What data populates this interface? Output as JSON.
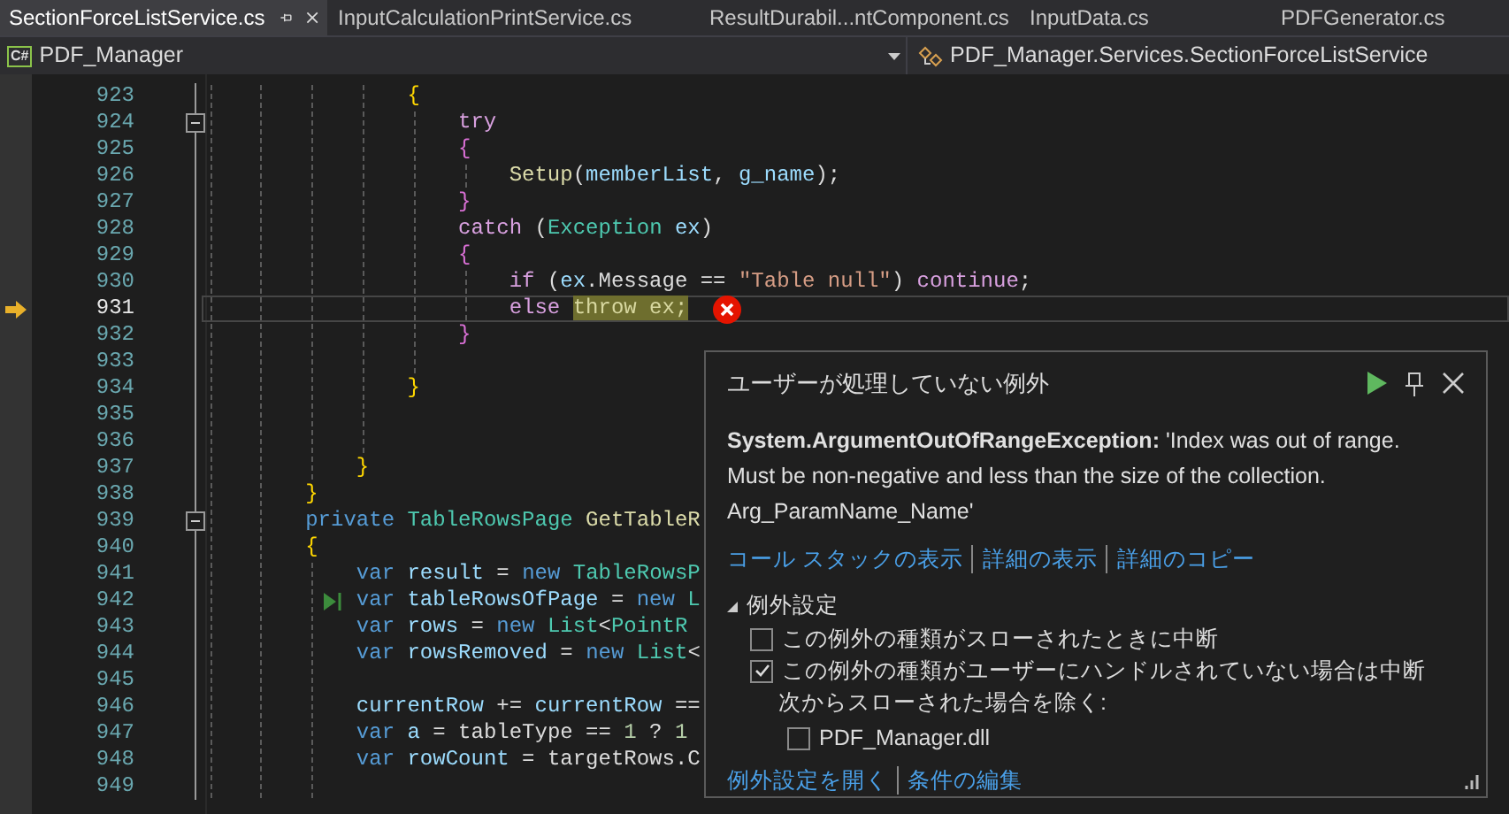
{
  "tabs": [
    {
      "label": "SectionForceListService.cs",
      "selected": true
    },
    {
      "label": "InputCalculationPrintService.cs",
      "selected": false
    },
    {
      "label": "ResultDurabil...ntComponent.cs",
      "selected": false
    },
    {
      "label": "InputData.cs",
      "selected": false
    },
    {
      "label": "PDFGenerator.cs",
      "selected": false
    }
  ],
  "navigation": {
    "project": "PDF_Manager",
    "project_icon": "C#",
    "member": "PDF_Manager.Services.SectionForceListService"
  },
  "editor": {
    "lines": [
      {
        "number": "923",
        "current": false,
        "foldable": false,
        "run_to_cursor": false,
        "error": false,
        "tokens": [
          {
            "text": "                {",
            "kind": "brace"
          }
        ]
      },
      {
        "number": "924",
        "current": false,
        "foldable": true,
        "run_to_cursor": false,
        "error": false,
        "tokens": [
          {
            "text": "                    try",
            "kind": "control"
          }
        ]
      },
      {
        "number": "925",
        "current": false,
        "foldable": false,
        "run_to_cursor": false,
        "error": false,
        "tokens": [
          {
            "text": "                    {",
            "kind": "inner-brace"
          }
        ]
      },
      {
        "number": "926",
        "current": false,
        "foldable": false,
        "run_to_cursor": false,
        "error": false,
        "tokens": [
          {
            "text": "                        Setup",
            "kind": "method"
          },
          {
            "text": "(",
            "kind": "plain"
          },
          {
            "text": "memberList",
            "kind": "local"
          },
          {
            "text": ", ",
            "kind": "plain"
          },
          {
            "text": "g_name",
            "kind": "local"
          },
          {
            "text": ");",
            "kind": "plain"
          }
        ]
      },
      {
        "number": "927",
        "current": false,
        "foldable": false,
        "run_to_cursor": false,
        "error": false,
        "tokens": [
          {
            "text": "                    }",
            "kind": "inner-brace"
          }
        ]
      },
      {
        "number": "928",
        "current": false,
        "foldable": false,
        "run_to_cursor": false,
        "error": false,
        "tokens": [
          {
            "text": "                    catch",
            "kind": "control"
          },
          {
            "text": " (",
            "kind": "plain"
          },
          {
            "text": "Exception",
            "kind": "type"
          },
          {
            "text": " ex",
            "kind": "local"
          },
          {
            "text": ")",
            "kind": "plain"
          }
        ]
      },
      {
        "number": "929",
        "current": false,
        "foldable": false,
        "run_to_cursor": false,
        "error": false,
        "tokens": [
          {
            "text": "                    {",
            "kind": "inner-brace"
          }
        ]
      },
      {
        "number": "930",
        "current": false,
        "foldable": false,
        "run_to_cursor": false,
        "error": false,
        "tokens": [
          {
            "text": "                        if",
            "kind": "control"
          },
          {
            "text": " (",
            "kind": "plain"
          },
          {
            "text": "ex",
            "kind": "local"
          },
          {
            "text": ".Message == ",
            "kind": "plain"
          },
          {
            "text": "\"Table null\"",
            "kind": "string"
          },
          {
            "text": ") ",
            "kind": "plain"
          },
          {
            "text": "continue",
            "kind": "control"
          },
          {
            "text": ";",
            "kind": "plain"
          }
        ]
      },
      {
        "number": "931",
        "current": true,
        "foldable": false,
        "run_to_cursor": false,
        "error": true,
        "tokens": [
          {
            "text": "                        else ",
            "kind": "control"
          },
          {
            "text": "throw ex;",
            "kind": "highlight"
          }
        ]
      },
      {
        "number": "932",
        "current": false,
        "foldable": false,
        "run_to_cursor": false,
        "error": false,
        "tokens": [
          {
            "text": "                    }",
            "kind": "inner-brace"
          }
        ]
      },
      {
        "number": "933",
        "current": false,
        "foldable": false,
        "run_to_cursor": false,
        "error": false
      },
      {
        "number": "934",
        "current": false,
        "foldable": false,
        "run_to_cursor": false,
        "error": false,
        "tokens": [
          {
            "text": "                }",
            "kind": "brace"
          }
        ]
      },
      {
        "number": "935",
        "current": false,
        "foldable": false,
        "run_to_cursor": false,
        "error": false
      },
      {
        "number": "936",
        "current": false,
        "foldable": false,
        "run_to_cursor": false,
        "error": false
      },
      {
        "number": "937",
        "current": false,
        "foldable": false,
        "run_to_cursor": false,
        "error": false,
        "tokens": [
          {
            "text": "            }",
            "kind": "brace"
          }
        ]
      },
      {
        "number": "938",
        "current": false,
        "foldable": false,
        "run_to_cursor": false,
        "error": false,
        "tokens": [
          {
            "text": "        }",
            "kind": "brace"
          }
        ]
      },
      {
        "number": "939",
        "current": false,
        "foldable": true,
        "run_to_cursor": false,
        "error": false,
        "tokens": [
          {
            "text": "        private",
            "kind": "keyword"
          },
          {
            "text": " TableRowsPage",
            "kind": "type"
          },
          {
            "text": " GetTableR",
            "kind": "method"
          }
        ]
      },
      {
        "number": "940",
        "current": false,
        "foldable": false,
        "run_to_cursor": false,
        "error": false,
        "tokens": [
          {
            "text": "        {",
            "kind": "brace"
          }
        ]
      },
      {
        "number": "941",
        "current": false,
        "foldable": false,
        "run_to_cursor": false,
        "error": false,
        "tokens": [
          {
            "text": "            var",
            "kind": "keyword"
          },
          {
            "text": " result",
            "kind": "local"
          },
          {
            "text": " = ",
            "kind": "plain"
          },
          {
            "text": "new",
            "kind": "keyword"
          },
          {
            "text": " TableRowsP",
            "kind": "type"
          }
        ]
      },
      {
        "number": "942",
        "current": false,
        "foldable": false,
        "run_to_cursor": true,
        "error": false,
        "tokens": [
          {
            "text": "            var",
            "kind": "keyword"
          },
          {
            "text": " tableRowsOfPage",
            "kind": "local"
          },
          {
            "text": " = ",
            "kind": "plain"
          },
          {
            "text": "new",
            "kind": "keyword"
          },
          {
            "text": " L",
            "kind": "type"
          }
        ]
      },
      {
        "number": "943",
        "current": false,
        "foldable": false,
        "run_to_cursor": false,
        "error": false,
        "tokens": [
          {
            "text": "            var",
            "kind": "keyword"
          },
          {
            "text": " rows",
            "kind": "local"
          },
          {
            "text": " = ",
            "kind": "plain"
          },
          {
            "text": "new",
            "kind": "keyword"
          },
          {
            "text": " List",
            "kind": "type"
          },
          {
            "text": "<",
            "kind": "plain"
          },
          {
            "text": "PointR",
            "kind": "type"
          }
        ]
      },
      {
        "number": "944",
        "current": false,
        "foldable": false,
        "run_to_cursor": false,
        "error": false,
        "tokens": [
          {
            "text": "            var",
            "kind": "keyword"
          },
          {
            "text": " rowsRemoved",
            "kind": "local"
          },
          {
            "text": " = ",
            "kind": "plain"
          },
          {
            "text": "new",
            "kind": "keyword"
          },
          {
            "text": " List",
            "kind": "type"
          },
          {
            "text": "<",
            "kind": "plain"
          }
        ]
      },
      {
        "number": "945",
        "current": false,
        "foldable": false,
        "run_to_cursor": false,
        "error": false
      },
      {
        "number": "946",
        "current": false,
        "foldable": false,
        "run_to_cursor": false,
        "error": false,
        "tokens": [
          {
            "text": "            currentRow",
            "kind": "local"
          },
          {
            "text": " += ",
            "kind": "plain"
          },
          {
            "text": "currentRow",
            "kind": "local"
          },
          {
            "text": " ==",
            "kind": "plain"
          }
        ]
      },
      {
        "number": "947",
        "current": false,
        "foldable": false,
        "run_to_cursor": false,
        "error": false,
        "tokens": [
          {
            "text": "            var",
            "kind": "keyword"
          },
          {
            "text": " a",
            "kind": "local"
          },
          {
            "text": " = tableType == ",
            "kind": "plain"
          },
          {
            "text": "1",
            "kind": "number"
          },
          {
            "text": " ? ",
            "kind": "plain"
          },
          {
            "text": "1",
            "kind": "number"
          }
        ]
      },
      {
        "number": "948",
        "current": false,
        "foldable": false,
        "run_to_cursor": false,
        "error": false,
        "tokens": [
          {
            "text": "            var",
            "kind": "keyword"
          },
          {
            "text": " rowCount",
            "kind": "local"
          },
          {
            "text": " = targetRows.C",
            "kind": "plain"
          }
        ]
      },
      {
        "number": "949",
        "current": false,
        "foldable": false,
        "run_to_cursor": false,
        "error": false
      }
    ]
  },
  "exception_popup": {
    "title": "ユーザーが処理していない例外",
    "message": "**System.ArgumentOutOfRangeException:** 'Index was out of range. Must be non-negative and less than the size of the collection.\nArg_ParamName_Name'",
    "actions": [
      "コール スタックの表示",
      "詳細の表示",
      "詳細のコピー"
    ],
    "settings": {
      "title": "例外設定",
      "expanded": true,
      "items": [
        {
          "kind": "checkbox",
          "label": "この例外の種類がスローされたときに中断",
          "checked": false
        },
        {
          "kind": "checkbox",
          "label": "この例外の種類がユーザーにハンドルされていない場合は中断",
          "checked": true
        },
        {
          "kind": "note",
          "label": "次からスローされた場合を除く:"
        },
        {
          "kind": "sub-checkbox",
          "label": "PDF_Manager.dll",
          "checked": false
        }
      ]
    },
    "footer_links": [
      "例外設定を開く",
      "条件の編集"
    ]
  }
}
